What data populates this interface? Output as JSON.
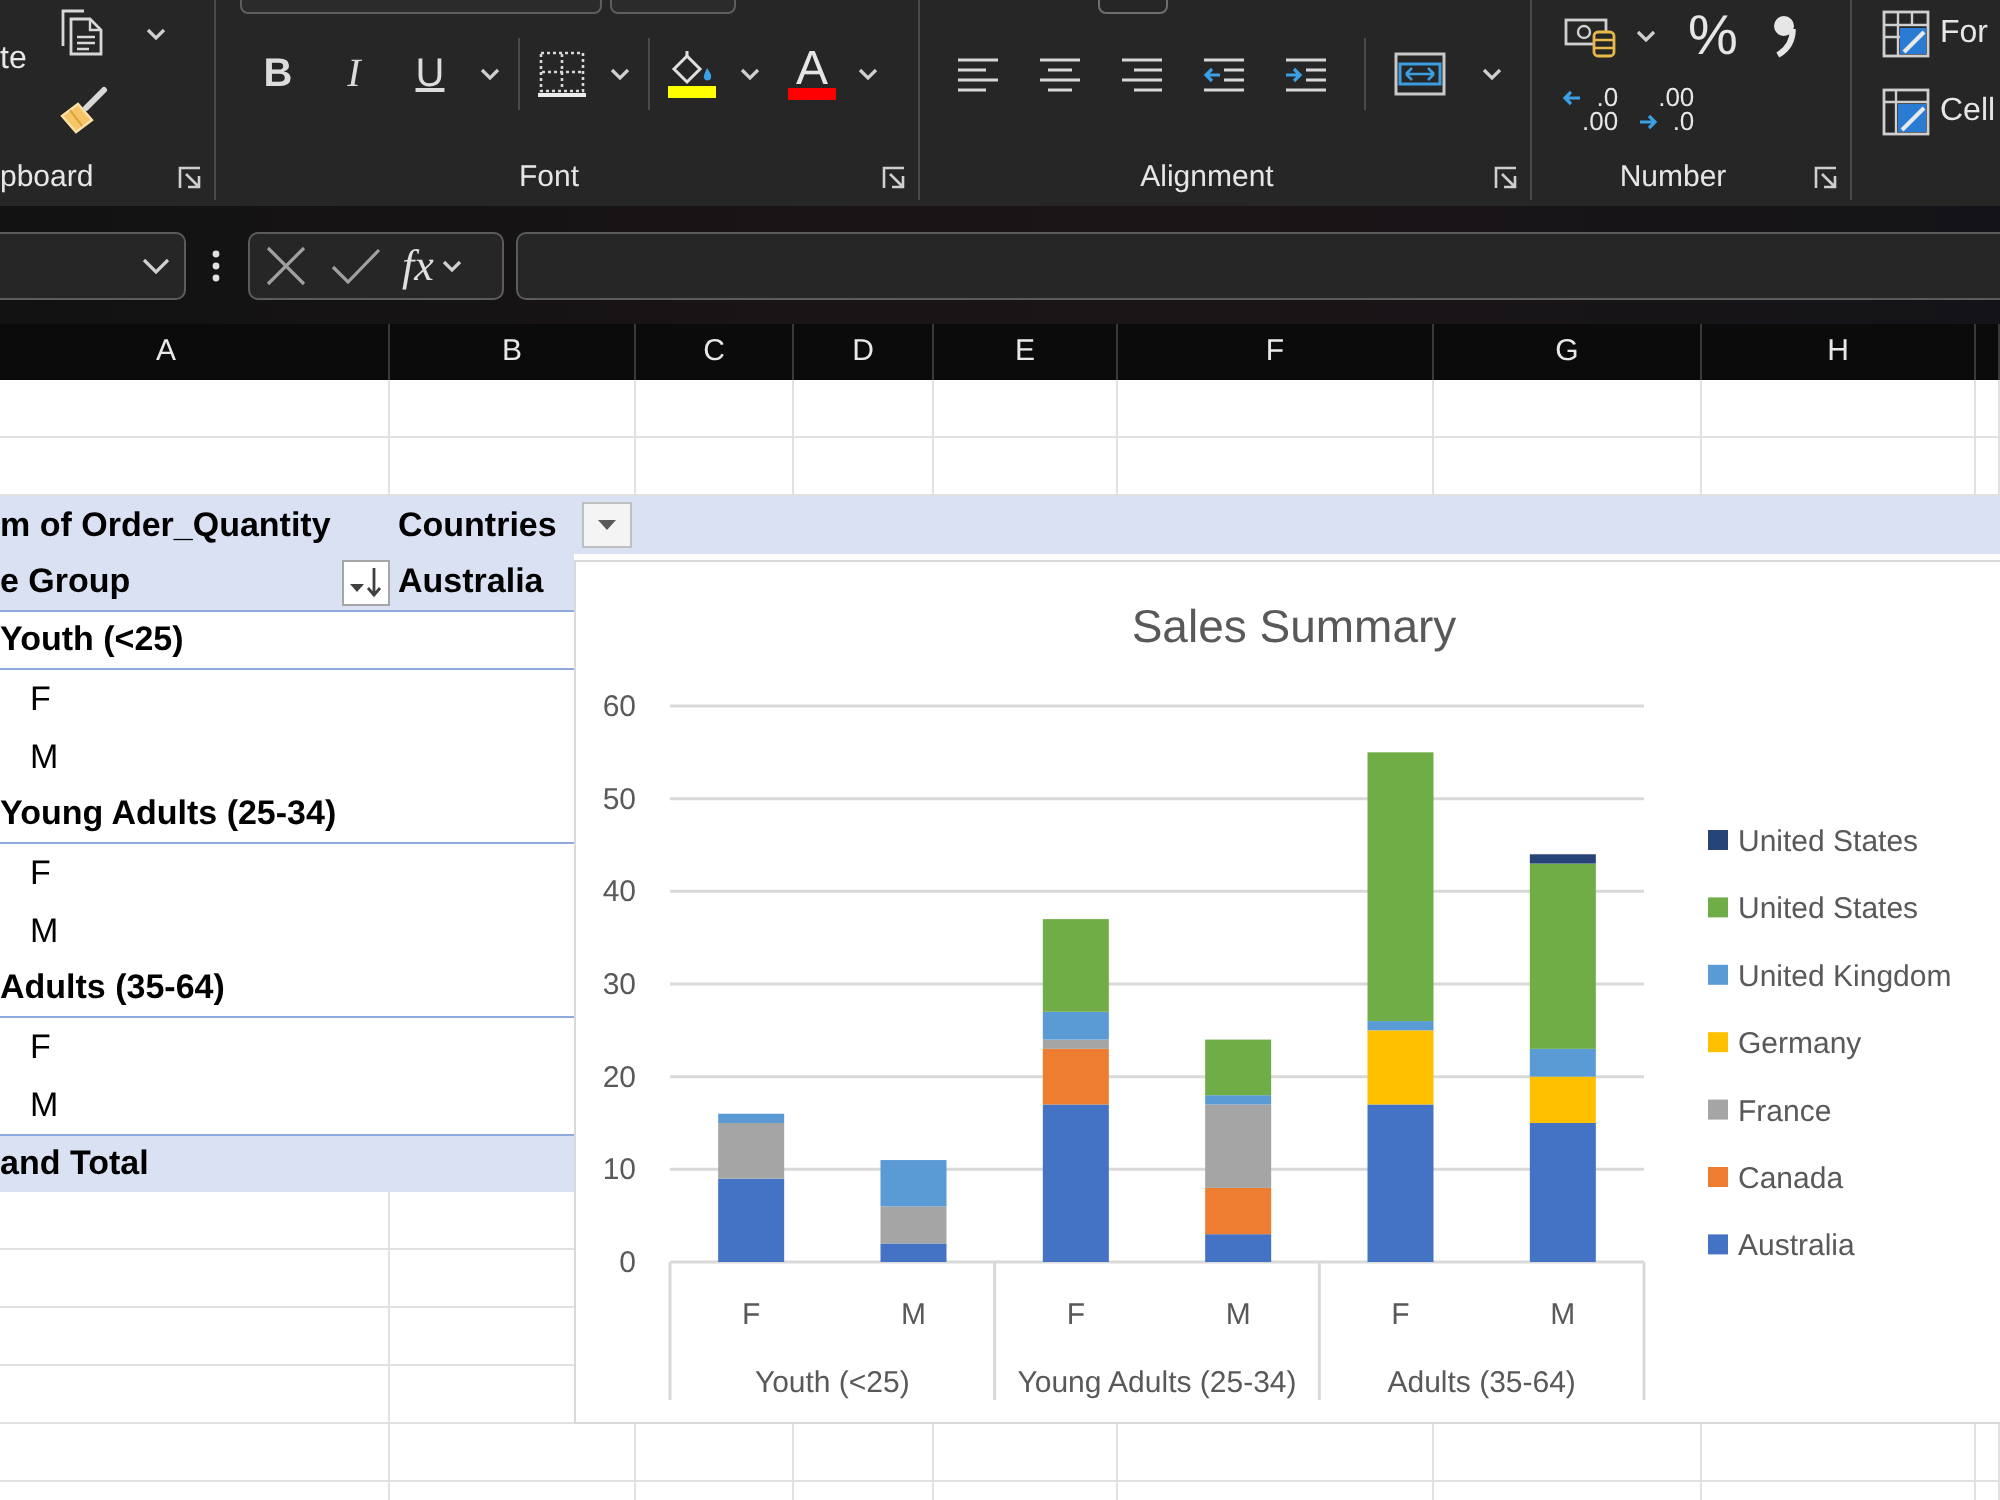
{
  "ribbon": {
    "groups": [
      {
        "kind": "clipboard",
        "paste_label": "te",
        "label": "pboard"
      },
      {
        "kind": "font",
        "format_buttons": [
          {
            "kind": "bold",
            "label": "B"
          },
          {
            "kind": "italic",
            "label": "I"
          },
          {
            "kind": "underline",
            "label": "U"
          }
        ],
        "color_buttons": [
          {
            "kind": "fill",
            "color": "#ffff00"
          },
          {
            "kind": "font",
            "label": "A",
            "color": "#ff0000"
          }
        ],
        "label": "Font"
      },
      {
        "kind": "alignment",
        "label": "Alignment"
      },
      {
        "kind": "number",
        "percent_label": "%",
        "decimal_buttons": [
          {
            "kind": "increase",
            "upper": ".0",
            "lower": ".00"
          },
          {
            "kind": "decrease",
            "upper": ".00",
            "lower": ".0"
          }
        ],
        "label": "Number"
      },
      {
        "kind": "styles",
        "buttons": [
          {
            "kind": "table",
            "label": "For"
          },
          {
            "kind": "cell",
            "label": "Cell"
          }
        ]
      }
    ]
  },
  "formula_bar": {
    "function_label": "fx"
  },
  "column_headers": [
    "A",
    "B",
    "C",
    "D",
    "E",
    "F",
    "G",
    "H"
  ],
  "pivot_table": {
    "value_field": "m of Order_Quantity",
    "column_field": "Countries",
    "row_field": "e Group",
    "column_items": [
      "Australia"
    ],
    "rows": [
      {
        "label": "Youth (<25)",
        "children": [
          {
            "label": "F"
          },
          {
            "label": "M"
          }
        ]
      },
      {
        "label": "Young Adults (25-34)",
        "children": [
          {
            "label": "F"
          },
          {
            "label": "M"
          }
        ]
      },
      {
        "label": "Adults (35-64)",
        "children": [
          {
            "label": "F"
          },
          {
            "label": "M"
          }
        ]
      }
    ],
    "grand_total": "and Total"
  },
  "chart": {
    "category_groups": [
      "Youth (<25)",
      "Young Adults (25-34)",
      "Adults (35-64)"
    ],
    "chart_data": {
      "type": "bar",
      "title": "Sales Summary",
      "categories": [
        "F",
        "M",
        "F",
        "M",
        "F",
        "M"
      ],
      "series": [
        {
          "name": "Australia",
          "color": "#4472c4",
          "values": [
            9,
            2,
            17,
            3,
            17,
            15
          ]
        },
        {
          "name": "Canada",
          "color": "#ed7d31",
          "values": [
            null,
            null,
            6,
            5,
            null,
            null
          ]
        },
        {
          "name": "France",
          "color": "#a5a5a5",
          "values": [
            6,
            4,
            1,
            9,
            null,
            null
          ]
        },
        {
          "name": "Germany",
          "color": "#ffc000",
          "values": [
            null,
            null,
            null,
            null,
            8,
            5
          ]
        },
        {
          "name": "United Kingdom",
          "color": "#5b9bd5",
          "values": [
            1,
            5,
            3,
            1,
            1,
            3
          ]
        },
        {
          "name": "United States",
          "color": "#70ad47",
          "values": [
            null,
            null,
            10,
            6,
            29,
            20
          ]
        },
        {
          "name": "United States",
          "color": "#264478",
          "values": [
            null,
            null,
            null,
            null,
            null,
            1
          ]
        }
      ],
      "ylim": [
        0,
        60
      ],
      "yticks": [
        0,
        10,
        20,
        30,
        40,
        50,
        60
      ],
      "stacked": true,
      "orientation": "vertical",
      "grid": true,
      "legend": "right"
    }
  }
}
